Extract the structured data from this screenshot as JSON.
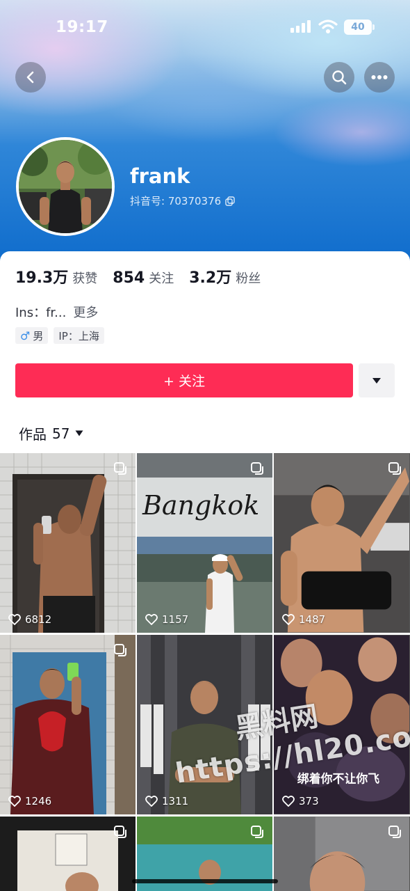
{
  "status_bar": {
    "time": "19:17",
    "battery": "40"
  },
  "profile": {
    "username": "frank",
    "douyin_id": "抖音号: 70370376",
    "stats": [
      {
        "value": "19.3万",
        "label": "获赞"
      },
      {
        "value": "854",
        "label": "关注"
      },
      {
        "value": "3.2万",
        "label": "粉丝"
      }
    ],
    "bio": "Ins：fr...",
    "bio_more": "更多",
    "tags": {
      "gender": "男",
      "ip": "IP：上海"
    }
  },
  "actions": {
    "follow_label": "+ 关注"
  },
  "works_tab": {
    "label": "作品",
    "count": "57"
  },
  "videos": [
    {
      "likes": "6812"
    },
    {
      "likes": "1157",
      "overlay_text": "Bangkok"
    },
    {
      "likes": "1487"
    },
    {
      "likes": "1246"
    },
    {
      "likes": "1311"
    },
    {
      "likes": "373",
      "overlay_text": "绑着你不让你飞"
    },
    {
      "likes": ""
    },
    {
      "likes": ""
    },
    {
      "likes": ""
    }
  ],
  "watermark": {
    "cn": "黑料网",
    "url": "https://hl20.co"
  },
  "colors": {
    "accent": "#fe2c55",
    "header_blue": "#0f6ccc"
  }
}
